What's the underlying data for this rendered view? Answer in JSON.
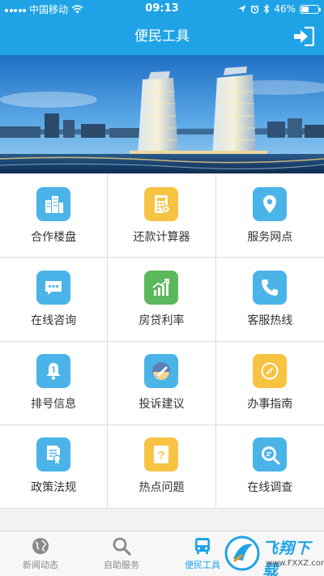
{
  "status": {
    "carrier": "中国移动",
    "time": "09:13",
    "battery": "46%",
    "battery_level": 0.46
  },
  "header": {
    "title": "便民工具"
  },
  "grid": [
    {
      "label": "合作楼盘",
      "icon": "buildings-icon",
      "color": "#4ab4e8"
    },
    {
      "label": "还款计算器",
      "icon": "calculator-icon",
      "color": "#f7c342"
    },
    {
      "label": "服务网点",
      "icon": "location-pin-icon",
      "color": "#4ab4e8"
    },
    {
      "label": "在线咨询",
      "icon": "chat-bubble-icon",
      "color": "#4ab4e8"
    },
    {
      "label": "房贷利率",
      "icon": "growth-chart-icon",
      "color": "#5cb85c"
    },
    {
      "label": "客服热线",
      "icon": "phone-icon",
      "color": "#4ab4e8"
    },
    {
      "label": "排号信息",
      "icon": "bell-icon",
      "color": "#4ab4e8"
    },
    {
      "label": "投诉建议",
      "icon": "feedback-pen-icon",
      "color": "#4ab4e8"
    },
    {
      "label": "办事指南",
      "icon": "compass-icon",
      "color": "#f7c342"
    },
    {
      "label": "政策法规",
      "icon": "document-badge-icon",
      "color": "#4ab4e8"
    },
    {
      "label": "热点问题",
      "icon": "question-icon",
      "color": "#f7c342"
    },
    {
      "label": "在线调查",
      "icon": "search-survey-icon",
      "color": "#4ab4e8"
    }
  ],
  "tabs": [
    {
      "label": "新闻动态",
      "icon": "globe-icon"
    },
    {
      "label": "自助服务",
      "icon": "search-icon"
    },
    {
      "label": "便民工具",
      "icon": "bus-icon"
    }
  ],
  "watermark": {
    "title": "飞翔下载",
    "url": "www.FXXZ.com"
  }
}
